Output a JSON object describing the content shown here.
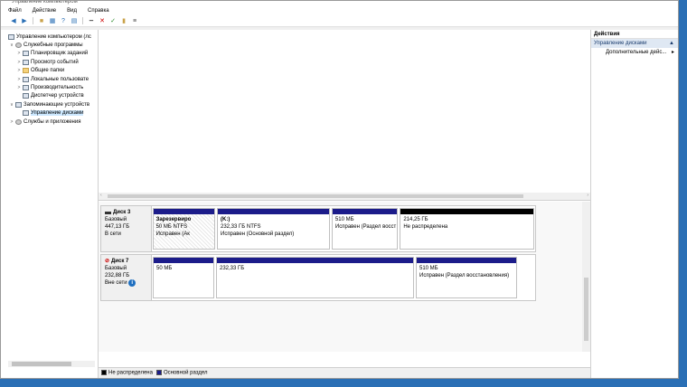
{
  "window": {
    "title": "Управление компьютером"
  },
  "menu": [
    "Файл",
    "Действие",
    "Вид",
    "Справка"
  ],
  "toolbar": [
    "back-arrow-icon",
    "forward-arrow-icon",
    "sep",
    "up-folder-icon",
    "properties-icon",
    "help-icon",
    "show-hide-icon",
    "sep",
    "connect-icon",
    "delete-icon",
    "check-icon",
    "refresh-icon",
    "list-icon"
  ],
  "tree": [
    {
      "label": "Управление компьютером (лс",
      "twisty": "",
      "indent": 0,
      "icon": "computer-icon"
    },
    {
      "label": "Служебные программы",
      "twisty": "∨",
      "indent": 1,
      "icon": "tools-icon"
    },
    {
      "label": "Планировщик заданий",
      "twisty": ">",
      "indent": 2,
      "icon": "scheduler-icon"
    },
    {
      "label": "Просмотр событий",
      "twisty": ">",
      "indent": 2,
      "icon": "event-viewer-icon"
    },
    {
      "label": "Общие папки",
      "twisty": ">",
      "indent": 2,
      "icon": "shared-folders-icon"
    },
    {
      "label": "Локальные пользовате",
      "twisty": ">",
      "indent": 2,
      "icon": "users-icon"
    },
    {
      "label": "Производительность",
      "twisty": ">",
      "indent": 2,
      "icon": "performance-icon"
    },
    {
      "label": "Диспетчер устройств",
      "twisty": "",
      "indent": 2,
      "icon": "device-manager-icon"
    },
    {
      "label": "Запоминающие устройств",
      "twisty": "∨",
      "indent": 1,
      "icon": "storage-icon"
    },
    {
      "label": "Управление дисками",
      "twisty": "",
      "indent": 2,
      "icon": "disk-management-icon",
      "selected": true
    },
    {
      "label": "Службы и приложения",
      "twisty": ">",
      "indent": 1,
      "icon": "services-icon"
    }
  ],
  "disks": [
    {
      "name": "Диск 3",
      "type": "Базовый",
      "size": "447,13 ГБ",
      "status": "В сети",
      "offline": false,
      "partitions": [
        {
          "title": "Зарезервиро",
          "line1": "50 МБ NTFS",
          "line2": "Исправен (Ак",
          "color": "primary",
          "hatch": true
        },
        {
          "title": "(K:)",
          "line1": "232,33 ГБ NTFS",
          "line2": "Исправен (Основной раздел)",
          "color": "primary"
        },
        {
          "title": "",
          "line1": "510 МБ",
          "line2": "Исправен (Раздел восст",
          "color": "primary"
        },
        {
          "title": "",
          "line1": "214,25 ГБ",
          "line2": "Не распределена",
          "color": "unallocated"
        }
      ]
    },
    {
      "name": "Диск 7",
      "type": "Базовый",
      "size": "232,88 ГБ",
      "status": "Вне сети",
      "offline": true,
      "partitions": [
        {
          "title": "",
          "line1": "50 МБ",
          "line2": "",
          "color": "primary"
        },
        {
          "title": "",
          "line1": "232,33 ГБ",
          "line2": "",
          "color": "primary"
        },
        {
          "title": "",
          "line1": "510 МБ",
          "line2": "Исправен (Раздел восстановления)",
          "color": "primary"
        }
      ]
    }
  ],
  "legend": [
    {
      "label": "Не распределена",
      "color": "#000000"
    },
    {
      "label": "Основной раздел",
      "color": "#1c1c8a"
    }
  ],
  "actions": {
    "header": "Действия",
    "section": "Управление дисками",
    "items": [
      "Дополнительные дейс..."
    ]
  }
}
